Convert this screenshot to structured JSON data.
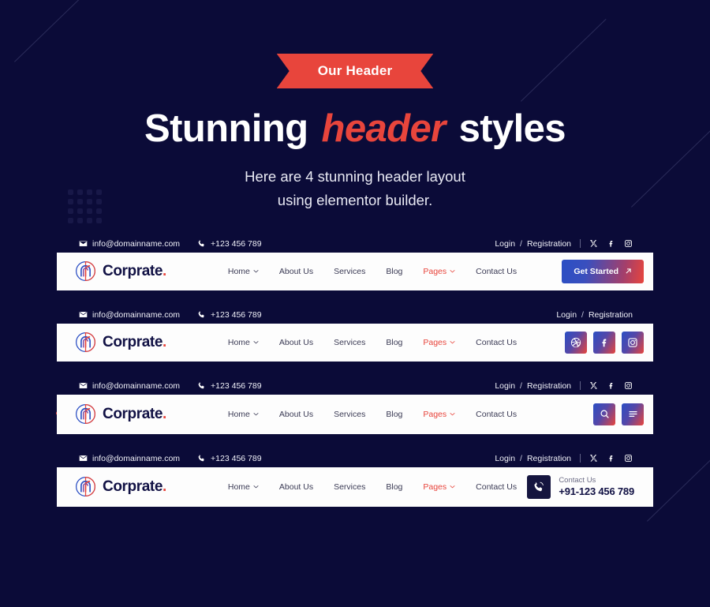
{
  "hero": {
    "ribbon_label": "Our Header",
    "headline_part1": "Stunning",
    "headline_accent": "header",
    "headline_part2": "styles",
    "subtitle_line1": "Here are 4 stunning header layout",
    "subtitle_line2": "using elementor builder."
  },
  "brand": {
    "name": "Corprate",
    "dot": "."
  },
  "topbar": {
    "email": "info@domainname.com",
    "phone": "+123 456 789",
    "login": "Login",
    "separator": "/",
    "registration": "Registration"
  },
  "menu": {
    "home": "Home",
    "about": "About Us",
    "services": "Services",
    "blog": "Blog",
    "pages": "Pages",
    "contact": "Contact Us"
  },
  "header1": {
    "cta_label": "Get Started"
  },
  "header4": {
    "contact_label": "Contact Us",
    "contact_number": "+91-123 456 789"
  },
  "colors": {
    "background": "#0b0b38",
    "accent_red": "#e8453c",
    "accent_blue": "#2b4fc4",
    "nav_background": "#fdfdfd",
    "brand_navy": "#111144"
  }
}
